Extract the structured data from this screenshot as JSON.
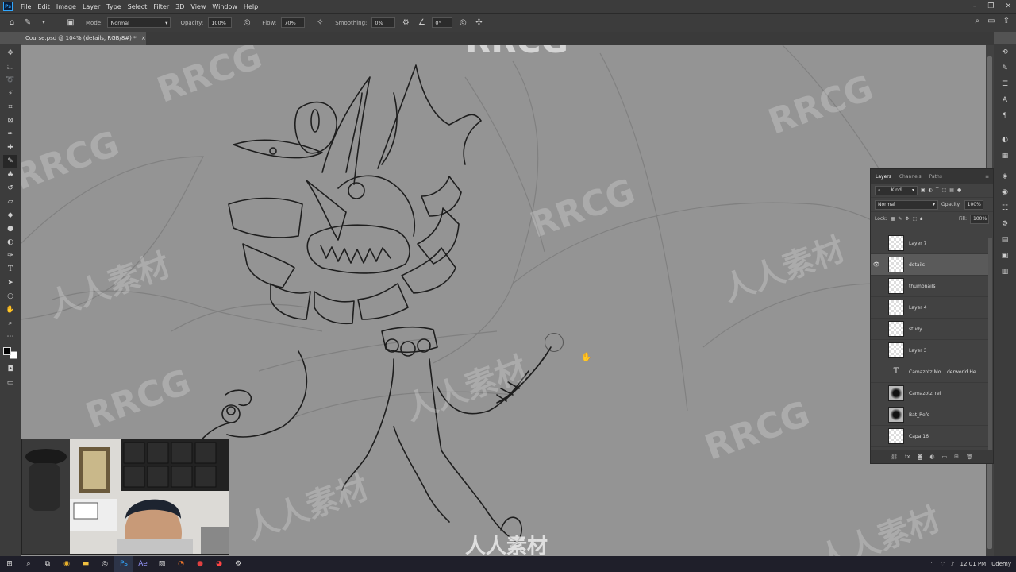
{
  "app": {
    "logo": "Ps"
  },
  "menu": [
    "File",
    "Edit",
    "Image",
    "Layer",
    "Type",
    "Select",
    "Filter",
    "3D",
    "View",
    "Window",
    "Help"
  ],
  "options": {
    "mode_label": "Mode:",
    "mode_value": "Normal",
    "opacity_label": "Opacity:",
    "opacity_value": "100%",
    "flow_label": "Flow:",
    "flow_value": "70%",
    "smoothing_label": "Smoothing:",
    "smoothing_value": "0%",
    "angle_value": "0°"
  },
  "document_tab": {
    "title": "Course.psd @ 104% (details, RGB/8#) *"
  },
  "watermark": "RRCG",
  "watermark_cn": "人人素材",
  "layers_panel": {
    "tabs": [
      "Layers",
      "Channels",
      "Paths"
    ],
    "filter_value": "Kind",
    "blend_mode": "Normal",
    "opacity_label": "Opacity:",
    "opacity_value": "100%",
    "lock_label": "Lock:",
    "fill_label": "Fill:",
    "fill_value": "100%",
    "layers": [
      {
        "name": "Layer 7",
        "visible": false,
        "selected": false,
        "kind": "pixel"
      },
      {
        "name": "details",
        "visible": true,
        "selected": true,
        "kind": "pixel"
      },
      {
        "name": "thumbnails",
        "visible": false,
        "selected": false,
        "kind": "pixel"
      },
      {
        "name": "Layer 4",
        "visible": false,
        "selected": false,
        "kind": "pixel"
      },
      {
        "name": "study",
        "visible": false,
        "selected": false,
        "kind": "pixel"
      },
      {
        "name": "Layer 3",
        "visible": false,
        "selected": false,
        "kind": "pixel"
      },
      {
        "name": "Camazotz Mo....derworld He",
        "visible": false,
        "selected": false,
        "kind": "text"
      },
      {
        "name": "Camazotz_ref",
        "visible": false,
        "selected": false,
        "kind": "image"
      },
      {
        "name": "Bat_Refs",
        "visible": false,
        "selected": false,
        "kind": "image"
      },
      {
        "name": "Capa 16",
        "visible": false,
        "selected": false,
        "kind": "pixel"
      }
    ]
  },
  "taskbar": {
    "clock": "12:01 PM",
    "udemy": "Udemy"
  },
  "colors": {
    "canvas": "#949494",
    "chrome": "#3c3c3c",
    "panel": "#424242",
    "selected_layer": "#5a5a5a"
  }
}
